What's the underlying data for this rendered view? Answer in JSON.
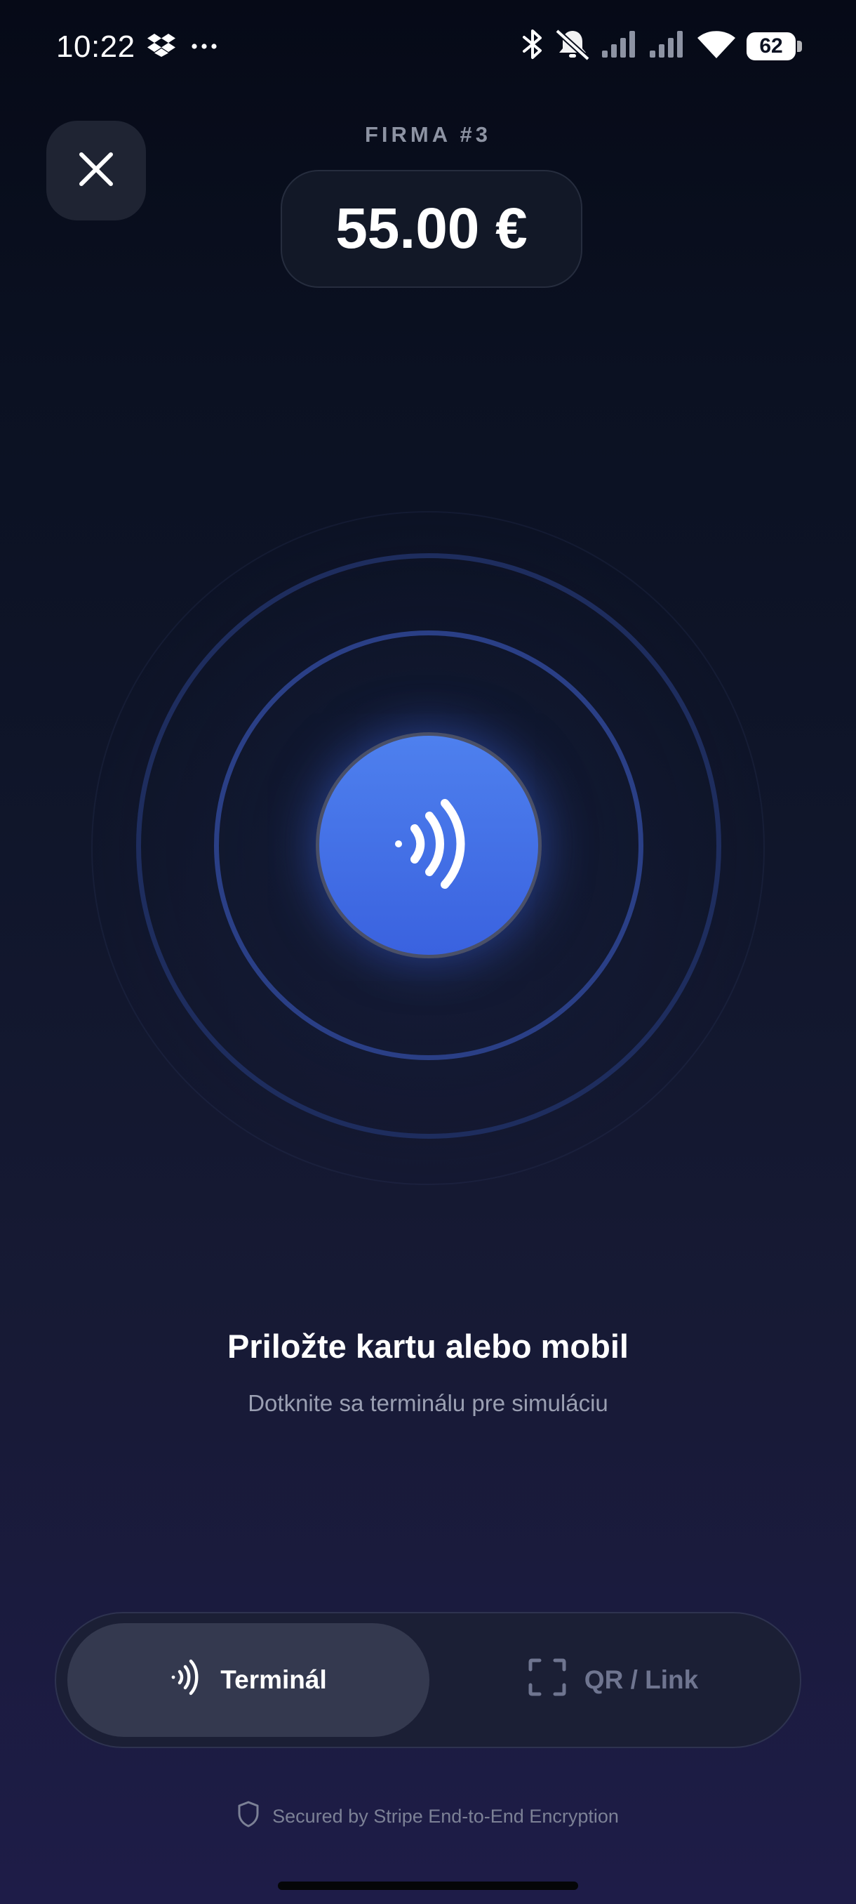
{
  "status_bar": {
    "time": "10:22",
    "battery": "62",
    "left_icons": [
      "dropbox-icon",
      "more-icon"
    ],
    "right_icons": [
      "bluetooth-icon",
      "mute-icon",
      "signal-icon",
      "signal-icon",
      "wifi-icon",
      "battery-icon"
    ]
  },
  "header": {
    "merchant": "FIRMA #3",
    "amount": "55.00 €",
    "close_icon": "close-icon"
  },
  "nfc": {
    "icon": "contactless-icon",
    "accent": "#4a78ec"
  },
  "prompt": {
    "title": "Priložte kartu alebo mobil",
    "subtitle": "Dotknite sa terminálu pre simuláciu"
  },
  "mode_switch": {
    "selected": "Terminál",
    "options": [
      {
        "label": "Terminál",
        "icon": "contactless-icon"
      },
      {
        "label": "QR / Link",
        "icon": "qr-scan-icon"
      }
    ]
  },
  "footer": {
    "secure_text": "Secured by Stripe End-to-End Encryption",
    "icon": "shield-icon"
  },
  "colors": {
    "background_top": "#060a17",
    "background_bottom": "#1e1c48",
    "ring_color": "#2a3f86",
    "active_segment": "#34394f"
  }
}
